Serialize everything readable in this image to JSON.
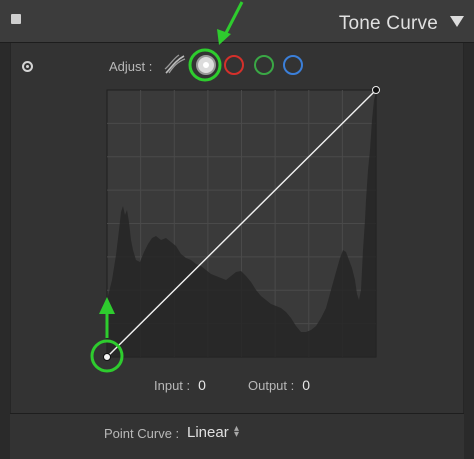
{
  "panel": {
    "title": "Tone Curve",
    "adjust_label": "Adjust :",
    "channels": [
      {
        "name": "RGB",
        "color": "#dcdcdc"
      },
      {
        "name": "Red",
        "color": "#d4302b"
      },
      {
        "name": "Green",
        "color": "#3aa845"
      },
      {
        "name": "Blue",
        "color": "#3b7fd9"
      }
    ]
  },
  "readout": {
    "input_label": "Input :",
    "input_value": "0",
    "output_label": "Output :",
    "output_value": "0"
  },
  "point_curve": {
    "label": "Point Curve :",
    "value": "Linear"
  },
  "curve": {
    "points": [
      [
        0,
        0
      ],
      [
        255,
        255
      ]
    ]
  },
  "annotation_color": "#2ecc2e"
}
